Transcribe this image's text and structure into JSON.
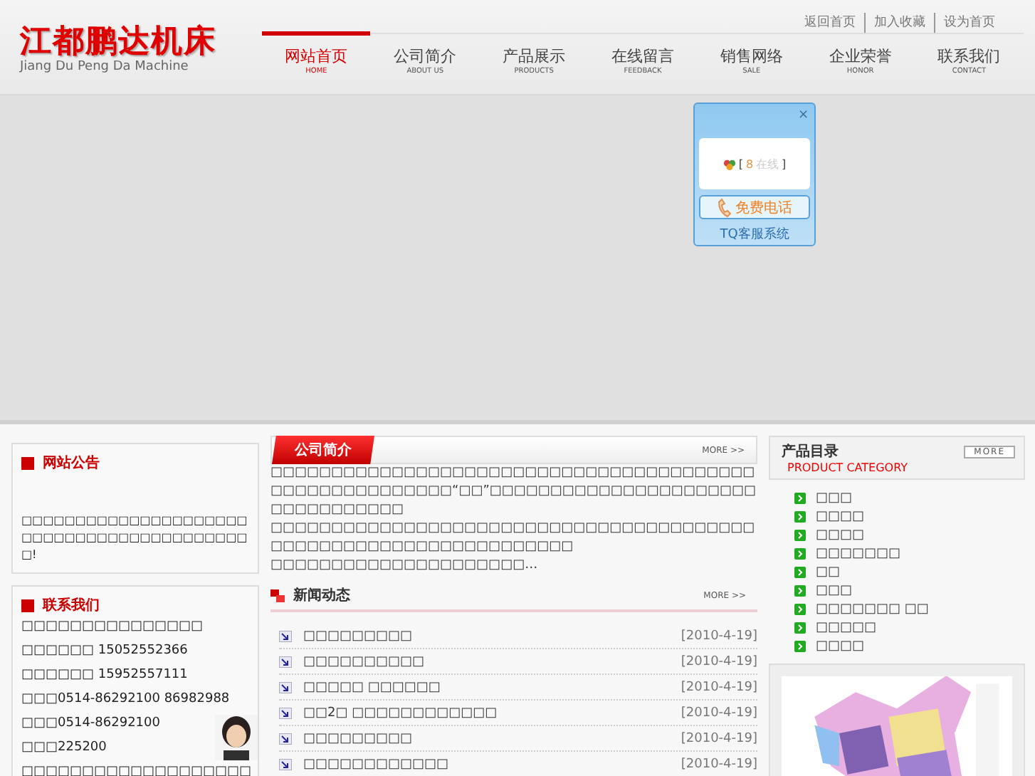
{
  "top_links": [
    "返回首页",
    "加入收藏",
    "设为首页"
  ],
  "logo": {
    "title": "江都鹏达机床",
    "subtitle": "Jiang Du Peng Da Machine"
  },
  "nav": [
    {
      "label": "网站首页",
      "sub": "HOME",
      "selected": true
    },
    {
      "label": "公司简介",
      "sub": "ABOUT US",
      "selected": false
    },
    {
      "label": "产品展示",
      "sub": "PRODUCTS",
      "selected": false
    },
    {
      "label": "在线留言",
      "sub": "FEEDBACK",
      "selected": false
    },
    {
      "label": "销售网络",
      "sub": "SALE",
      "selected": false
    },
    {
      "label": "企业荣誉",
      "sub": "HONOR",
      "selected": false
    },
    {
      "label": "联系我们",
      "sub": "CONTACT",
      "selected": false
    }
  ],
  "chat_widget": {
    "close": "×",
    "status_open": "[",
    "status_icon": "8",
    "status_text": "在线",
    "status_close": "]",
    "call_button": "免费电话",
    "footer": "TQ客服系统"
  },
  "notice": {
    "title": "网站公告",
    "text": "□□□□□□□□□□□□□□□□□□□□□□□□□□□□□□□□□□□□□□□□□□□!"
  },
  "contact": {
    "title": "联系我们",
    "lines": [
      "□□□□□□□□□□□□□□□",
      "□□□□□□ 15052552366",
      "□□□□□□ 15952557111",
      "□□□0514-86292100 86982988",
      "□□□0514-86292100",
      "□□□225200",
      "□□□□□□□□□□□□□□□□□□□"
    ]
  },
  "about": {
    "title": "公司简介",
    "more": "MORE >>",
    "paragraphs": [
      "□□□□□□□□□□□□□□□□□□□□□□□□□□□□□□□□□□□□□□□□□□□□□□□□□□□□□□□“□□”□□□□□□□□□□□□□□□□□□□□□□□□□□□□□□□□□",
      "□□□□□□□□□□□□□□□□□□□□□□□□□□□□□□□□□□□□□□□□□□□□□□□□□□□□□□□□□□□□□□□□□",
      "□□□□□□□□□□□□□□□□□□□□□…"
    ]
  },
  "news": {
    "title": "新闻动态",
    "more": "MORE >>",
    "items": [
      {
        "title": "□□□□□□□□□",
        "date": "[2010-4-19]"
      },
      {
        "title": "□□□□□□□□□□",
        "date": "[2010-4-19]"
      },
      {
        "title": "□□□□□ □□□□□□",
        "date": "[2010-4-19]"
      },
      {
        "title": "□□2□ □□□□□□□□□□□□",
        "date": "[2010-4-19]"
      },
      {
        "title": "□□□□□□□□□",
        "date": "[2010-4-19]"
      },
      {
        "title": "□□□□□□□□□□□□",
        "date": "[2010-4-19]"
      }
    ]
  },
  "products": {
    "title": "产品目录",
    "subtitle": "PRODUCT CATEGORY",
    "more": "MORE",
    "items": [
      "□□□",
      "□□□□",
      "□□□□",
      "□□□□□□□",
      "□□",
      "□□□",
      "□□□□□□□ □□",
      "□□□□□",
      "□□□□"
    ]
  }
}
